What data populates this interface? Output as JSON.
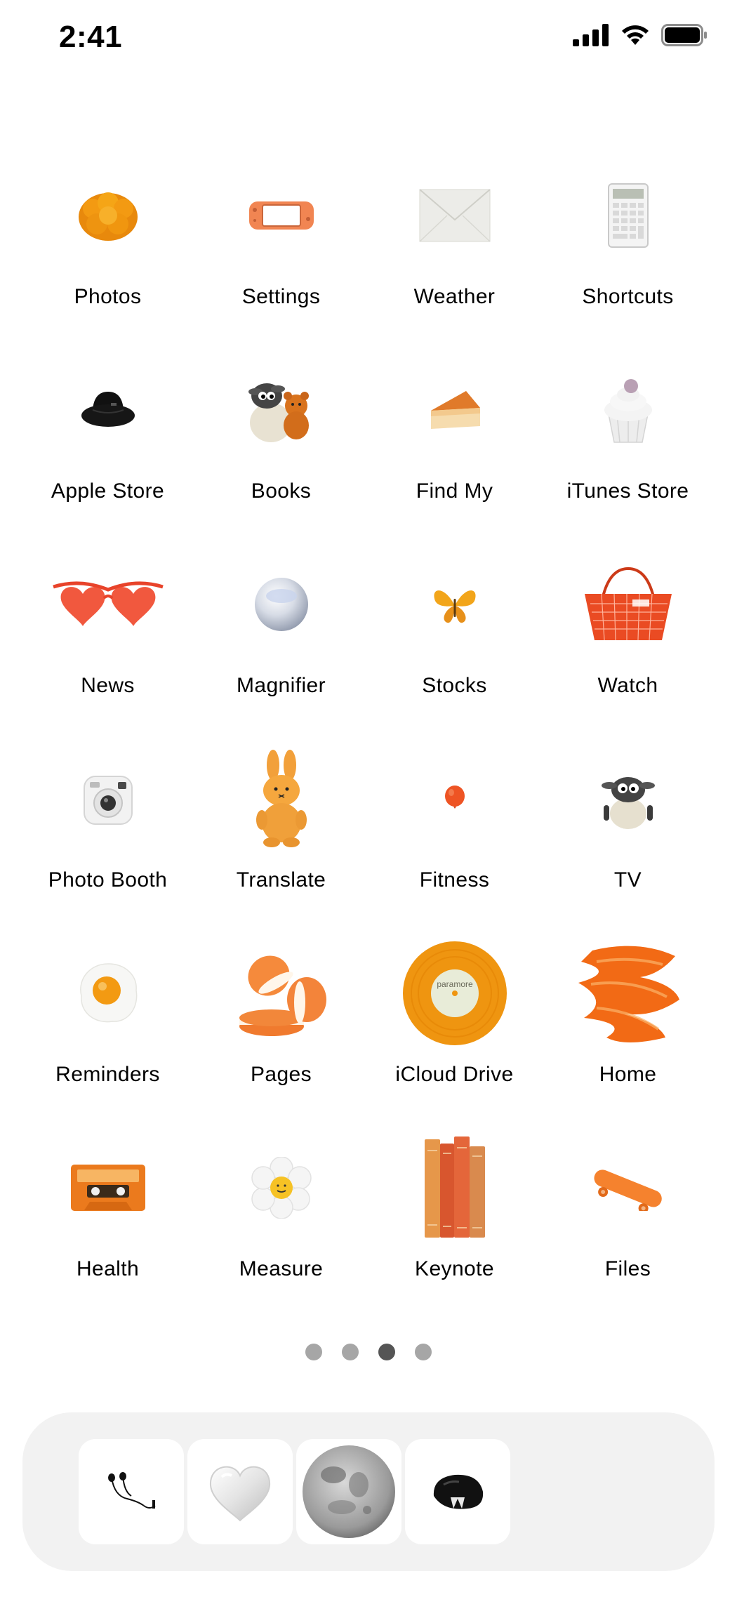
{
  "status_bar": {
    "time": "2:41",
    "signal_icon": "cellular-signal-icon",
    "wifi_icon": "wifi-icon",
    "battery_icon": "battery-full-icon"
  },
  "apps": [
    {
      "label": "Photos",
      "icon": "marigold-flower-icon"
    },
    {
      "label": "Settings",
      "icon": "game-console-icon"
    },
    {
      "label": "Weather",
      "icon": "envelope-icon"
    },
    {
      "label": "Shortcuts",
      "icon": "calculator-icon"
    },
    {
      "label": "Apple Store",
      "icon": "bucket-hat-icon"
    },
    {
      "label": "Books",
      "icon": "sheep-with-teddy-icon"
    },
    {
      "label": "Find My",
      "icon": "cheesecake-slice-icon"
    },
    {
      "label": "iTunes Store",
      "icon": "cupcake-icon"
    },
    {
      "label": "News",
      "icon": "heart-sunglasses-icon"
    },
    {
      "label": "Magnifier",
      "icon": "glass-marble-icon"
    },
    {
      "label": "Stocks",
      "icon": "butterfly-icon"
    },
    {
      "label": "Watch",
      "icon": "shopping-basket-icon"
    },
    {
      "label": "Photo Booth",
      "icon": "instant-camera-icon"
    },
    {
      "label": "Translate",
      "icon": "bunny-plush-icon"
    },
    {
      "label": "Fitness",
      "icon": "balloon-icon"
    },
    {
      "label": "TV",
      "icon": "sheep-figure-icon"
    },
    {
      "label": "Reminders",
      "icon": "fried-egg-icon"
    },
    {
      "label": "Pages",
      "icon": "macarons-icon"
    },
    {
      "label": "iCloud Drive",
      "icon": "vinyl-record-icon",
      "record_text": "paramore"
    },
    {
      "label": "Home",
      "icon": "paint-stroke-icon"
    },
    {
      "label": "Health",
      "icon": "cassette-tape-icon"
    },
    {
      "label": "Measure",
      "icon": "daisy-flower-icon"
    },
    {
      "label": "Keynote",
      "icon": "books-icon"
    },
    {
      "label": "Files",
      "icon": "skateboard-icon"
    }
  ],
  "page_dots": {
    "count": 4,
    "active": 3
  },
  "dock": [
    {
      "icon": "earphones-icon"
    },
    {
      "icon": "glass-heart-icon"
    },
    {
      "icon": "moon-icon"
    },
    {
      "icon": "black-rock-icon"
    }
  ],
  "colors": {
    "accent": "#f08a2a",
    "dot_inactive": "#a6a6a6",
    "dot_active": "#555555",
    "dock_bg": "#f2f2f2"
  }
}
